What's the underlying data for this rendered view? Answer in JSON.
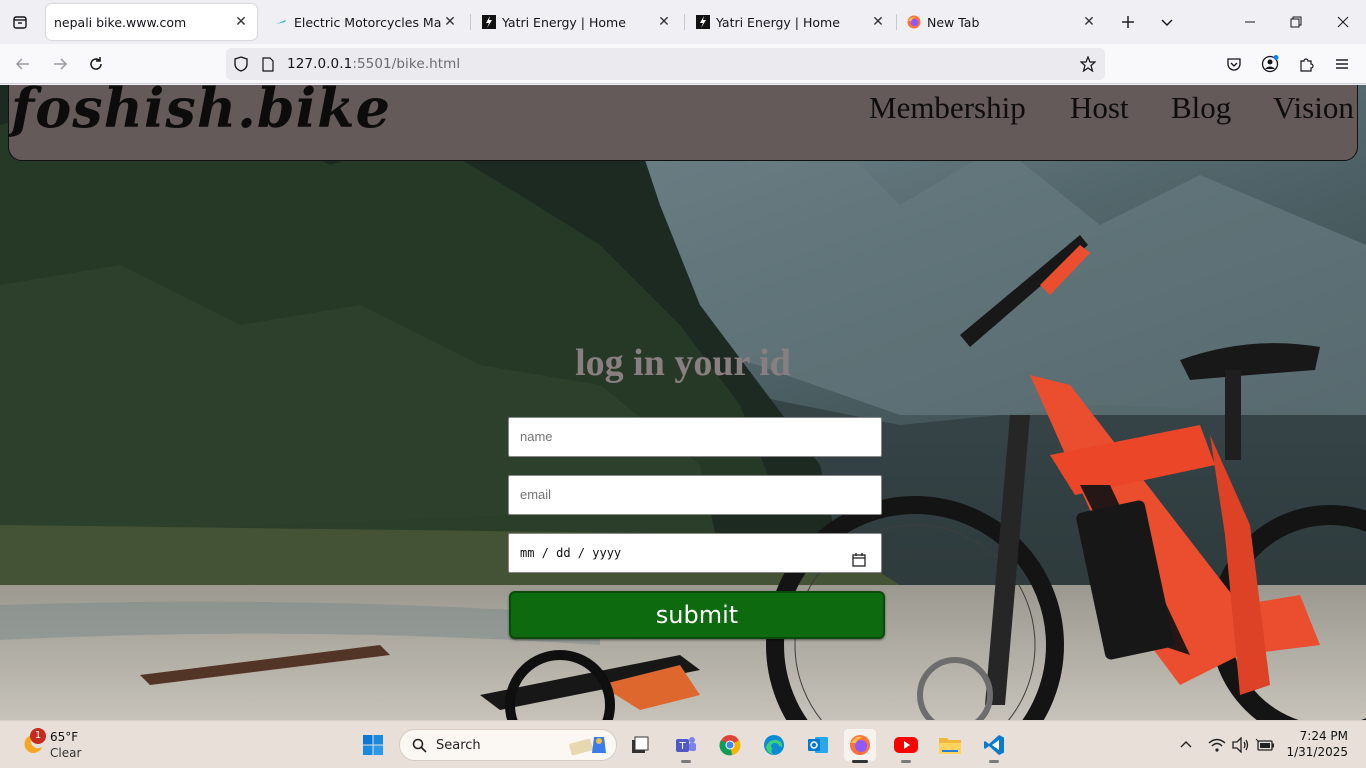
{
  "browser": {
    "tabs": [
      {
        "title": "nepali bike.www.com",
        "active": true,
        "favicon": "none"
      },
      {
        "title": "Electric Motorcycles Made in",
        "active": false,
        "favicon": "electric-bolt-icon"
      },
      {
        "title": "Yatri Energy | Home",
        "active": false,
        "favicon": "yatri-logo-icon"
      },
      {
        "title": "Yatri Energy | Home",
        "active": false,
        "favicon": "yatri-logo-icon"
      },
      {
        "title": "New Tab",
        "active": false,
        "favicon": "firefox-icon"
      }
    ],
    "url": {
      "host": "127.0.0.1",
      "port_path": ":5501/bike.html"
    }
  },
  "site": {
    "logo": "foshish.bike",
    "nav": [
      "Membership",
      "Host",
      "Blog",
      "Vision"
    ],
    "login": {
      "title": "log in your id",
      "name_placeholder": "name",
      "email_placeholder": "email",
      "date_placeholder": "mm / dd / yyyy",
      "submit_label": "submit"
    }
  },
  "taskbar": {
    "weather": {
      "badge": "1",
      "temp": "65°F",
      "condition": "Clear"
    },
    "search_label": "Search",
    "time": "7:24 PM",
    "date": "1/31/2025"
  },
  "colors": {
    "header_bg": "#645a59",
    "submit_bg": "#0e6a0e",
    "title_color": "#8a7f80",
    "bike_accent": "#ff5533"
  }
}
